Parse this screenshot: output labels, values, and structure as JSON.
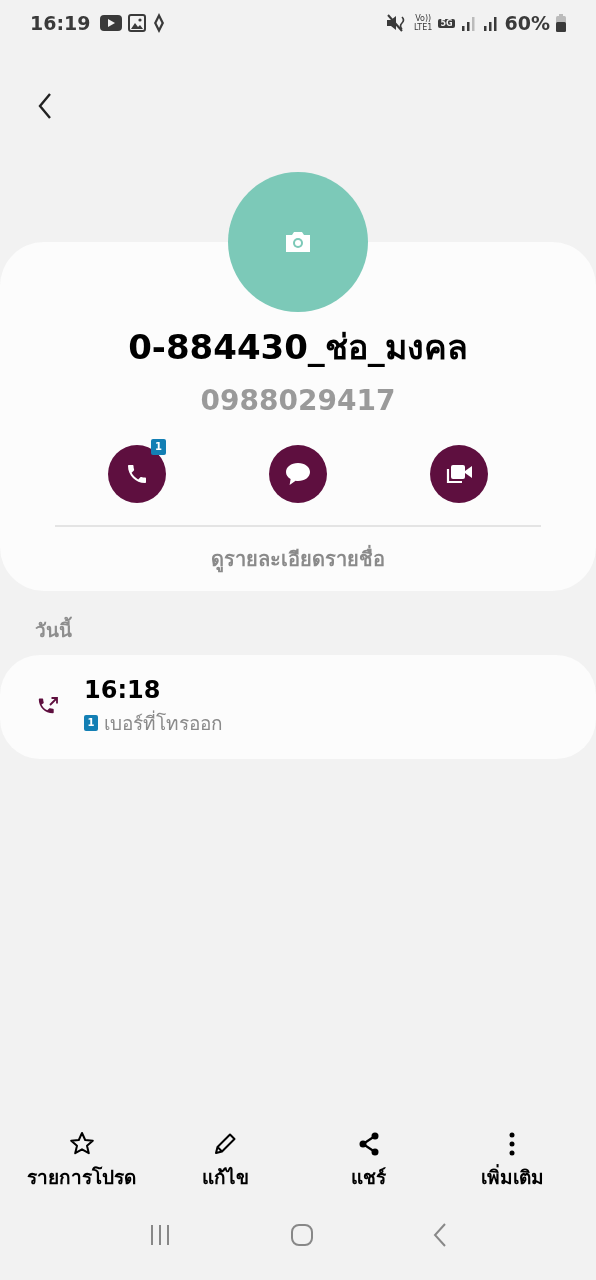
{
  "status_bar": {
    "time": "16:19",
    "volte": "Vo))",
    "lte": "LTE1",
    "network": "5G",
    "battery": "60%"
  },
  "contact": {
    "name": "0-884430_ช่อ_มงคล",
    "number": "0988029417"
  },
  "actions": [
    {
      "kind": "call",
      "badge": "1"
    },
    {
      "kind": "message"
    },
    {
      "kind": "video"
    }
  ],
  "details_link": "ดูรายละเอียดรายชื่อ",
  "section_label": "วันนี้",
  "calls": [
    {
      "kind": "outgoing",
      "time": "16:18",
      "sim": "1",
      "label": "เบอร์ที่โทรออก"
    }
  ],
  "bottom_actions": [
    {
      "kind": "favorite",
      "label": "รายการโปรด"
    },
    {
      "kind": "edit",
      "label": "แก้ไข"
    },
    {
      "kind": "share",
      "label": "แชร์"
    },
    {
      "kind": "more",
      "label": "เพิ่มเติม"
    }
  ]
}
